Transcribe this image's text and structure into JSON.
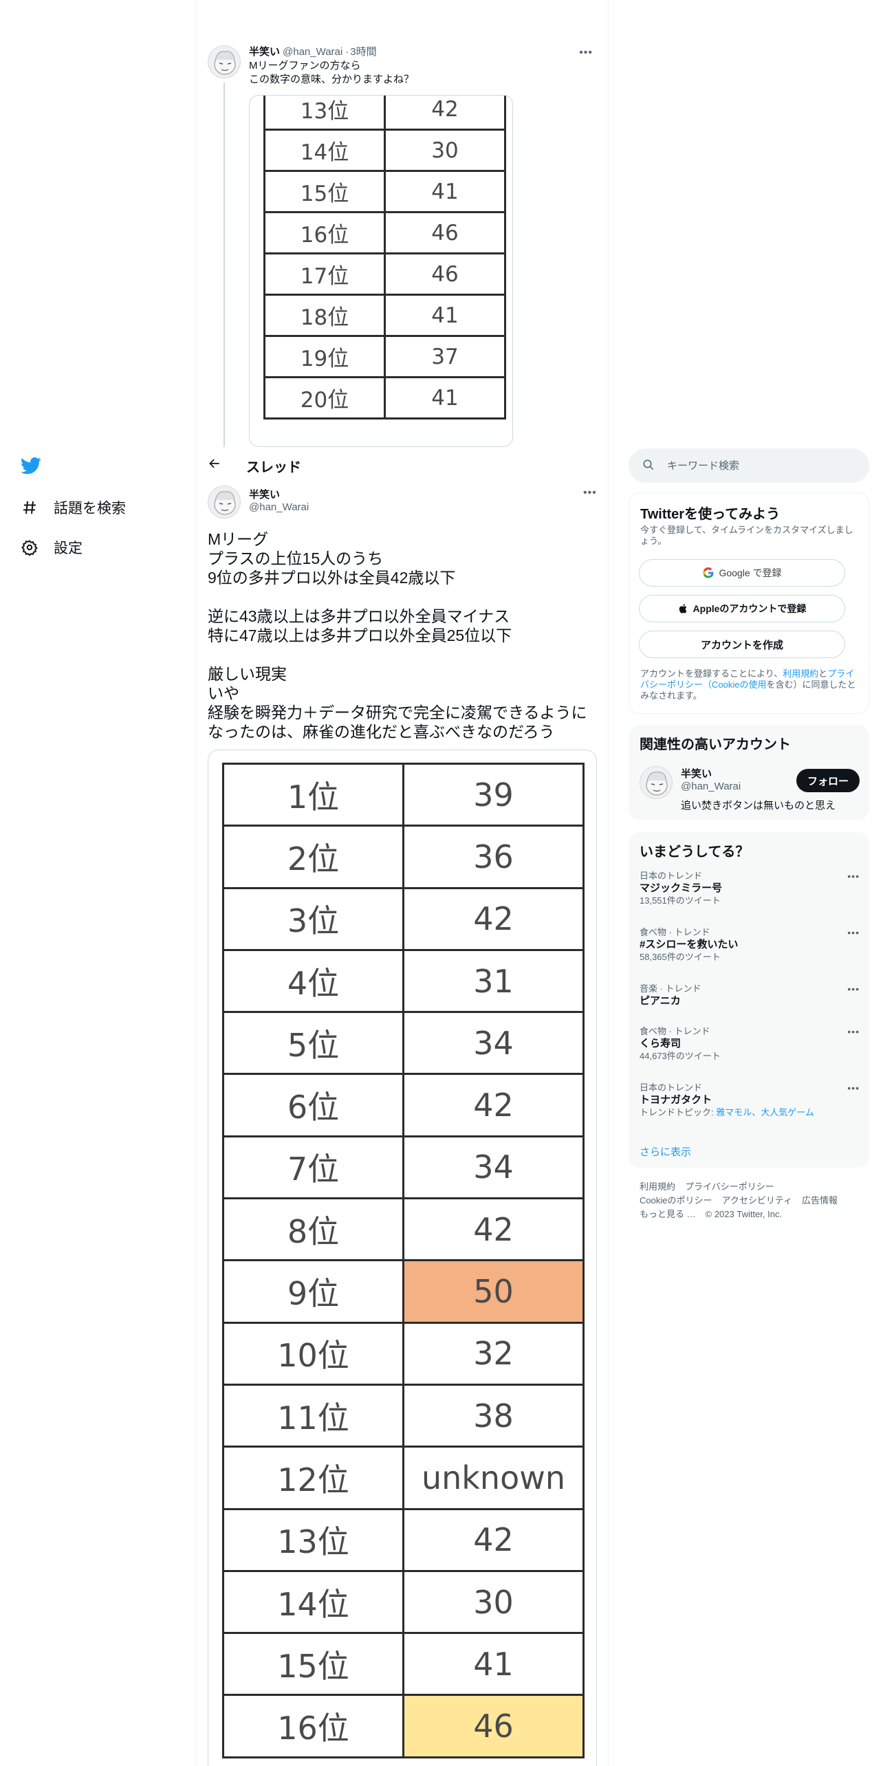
{
  "nav": {
    "explore_label": "話題を検索",
    "settings_label": "設定",
    "brand_color": "#1d9bf0"
  },
  "quoted_tweet": {
    "name": "半笑い",
    "handle": "@han_Warai",
    "separator": "·",
    "time": "3時間",
    "text_lines": [
      "Mリーグファンの方なら",
      "この数字の意味、分かりますよね？"
    ],
    "table_rows": [
      [
        "13位",
        "42"
      ],
      [
        "14位",
        "30"
      ],
      [
        "15位",
        "41"
      ],
      [
        "16位",
        "46"
      ],
      [
        "17位",
        "46"
      ],
      [
        "18位",
        "41"
      ],
      [
        "19位",
        "37"
      ],
      [
        "20位",
        "41"
      ]
    ]
  },
  "thread": {
    "title": "スレッド"
  },
  "main_tweet": {
    "name": "半笑い",
    "handle": "@han_Warai",
    "text_lines": [
      "Mリーグ",
      "プラスの上位15人のうち",
      "9位の多井プロ以外は全員42歳以下",
      "",
      "逆に43歳以上は多井プロ以外全員マイナス",
      "特に47歳以上は多井プロ以外全員25位以下",
      "",
      "厳しい現実",
      "いや",
      "経験を瞬発力＋データ研究で完全に凌駕できるように",
      "なったのは、麻雀の進化だと喜ぶべきなのだろう"
    ],
    "table_rows": [
      {
        "rank": "1位",
        "age": "39",
        "highlight": ""
      },
      {
        "rank": "2位",
        "age": "36",
        "highlight": ""
      },
      {
        "rank": "3位",
        "age": "42",
        "highlight": ""
      },
      {
        "rank": "4位",
        "age": "31",
        "highlight": ""
      },
      {
        "rank": "5位",
        "age": "34",
        "highlight": ""
      },
      {
        "rank": "6位",
        "age": "42",
        "highlight": ""
      },
      {
        "rank": "7位",
        "age": "34",
        "highlight": ""
      },
      {
        "rank": "8位",
        "age": "42",
        "highlight": ""
      },
      {
        "rank": "9位",
        "age": "50",
        "highlight": "orange"
      },
      {
        "rank": "10位",
        "age": "32",
        "highlight": ""
      },
      {
        "rank": "11位",
        "age": "38",
        "highlight": ""
      },
      {
        "rank": "12位",
        "age": "unknown",
        "highlight": ""
      },
      {
        "rank": "13位",
        "age": "42",
        "highlight": ""
      },
      {
        "rank": "14位",
        "age": "30",
        "highlight": ""
      },
      {
        "rank": "15位",
        "age": "41",
        "highlight": ""
      },
      {
        "rank": "16位",
        "age": "46",
        "highlight": "yellow"
      }
    ],
    "highlight_colors": {
      "orange": "#f4b183",
      "yellow": "#ffe699"
    }
  },
  "search": {
    "placeholder": "キーワード検索"
  },
  "signup": {
    "title": "Twitterを使ってみよう",
    "subtitle": "今すぐ登録して、タイムラインをカスタマイズしましょう。",
    "google_label": "Google で登録",
    "apple_label": "Appleのアカウントで登録",
    "create_label": "アカウントを作成",
    "terms_prefix": "アカウントを登録することにより、",
    "terms_link": "利用規約",
    "terms_and": "と",
    "privacy_link": "プライバシーポリシー（Cookieの使用",
    "terms_suffix": "を含む）に同意したとみなされます。"
  },
  "related": {
    "title": "関連性の高いアカウント",
    "name": "半笑い",
    "handle": "@han_Warai",
    "bio": "追い焚きボタンは無いものと思え",
    "follow_label": "フォロー"
  },
  "trends": {
    "title": "いまどうしてる？",
    "items": [
      {
        "meta": "日本のトレンド",
        "name": "マジックミラー号",
        "count": "13,551件のツイート"
      },
      {
        "meta": "食べ物 · トレンド",
        "name": "#スシローを救いたい",
        "count": "58,365件のツイート"
      },
      {
        "meta": "音楽 · トレンド",
        "name": "ピアニカ",
        "count": ""
      },
      {
        "meta": "食べ物 · トレンド",
        "name": "くら寿司",
        "count": "44,673件のツイート"
      },
      {
        "meta": "日本のトレンド",
        "name": "トヨナガタクト",
        "count": "トレンドトピック: ",
        "topics": "雅マモル、大人気ゲーム"
      }
    ],
    "show_more": "さらに表示"
  },
  "footer": {
    "links": [
      "利用規約",
      "プライバシーポリシー",
      "Cookieのポリシー",
      "アクセシビリティ",
      "広告情報",
      "もっと見る …"
    ],
    "copyright": "© 2023 Twitter, Inc."
  }
}
